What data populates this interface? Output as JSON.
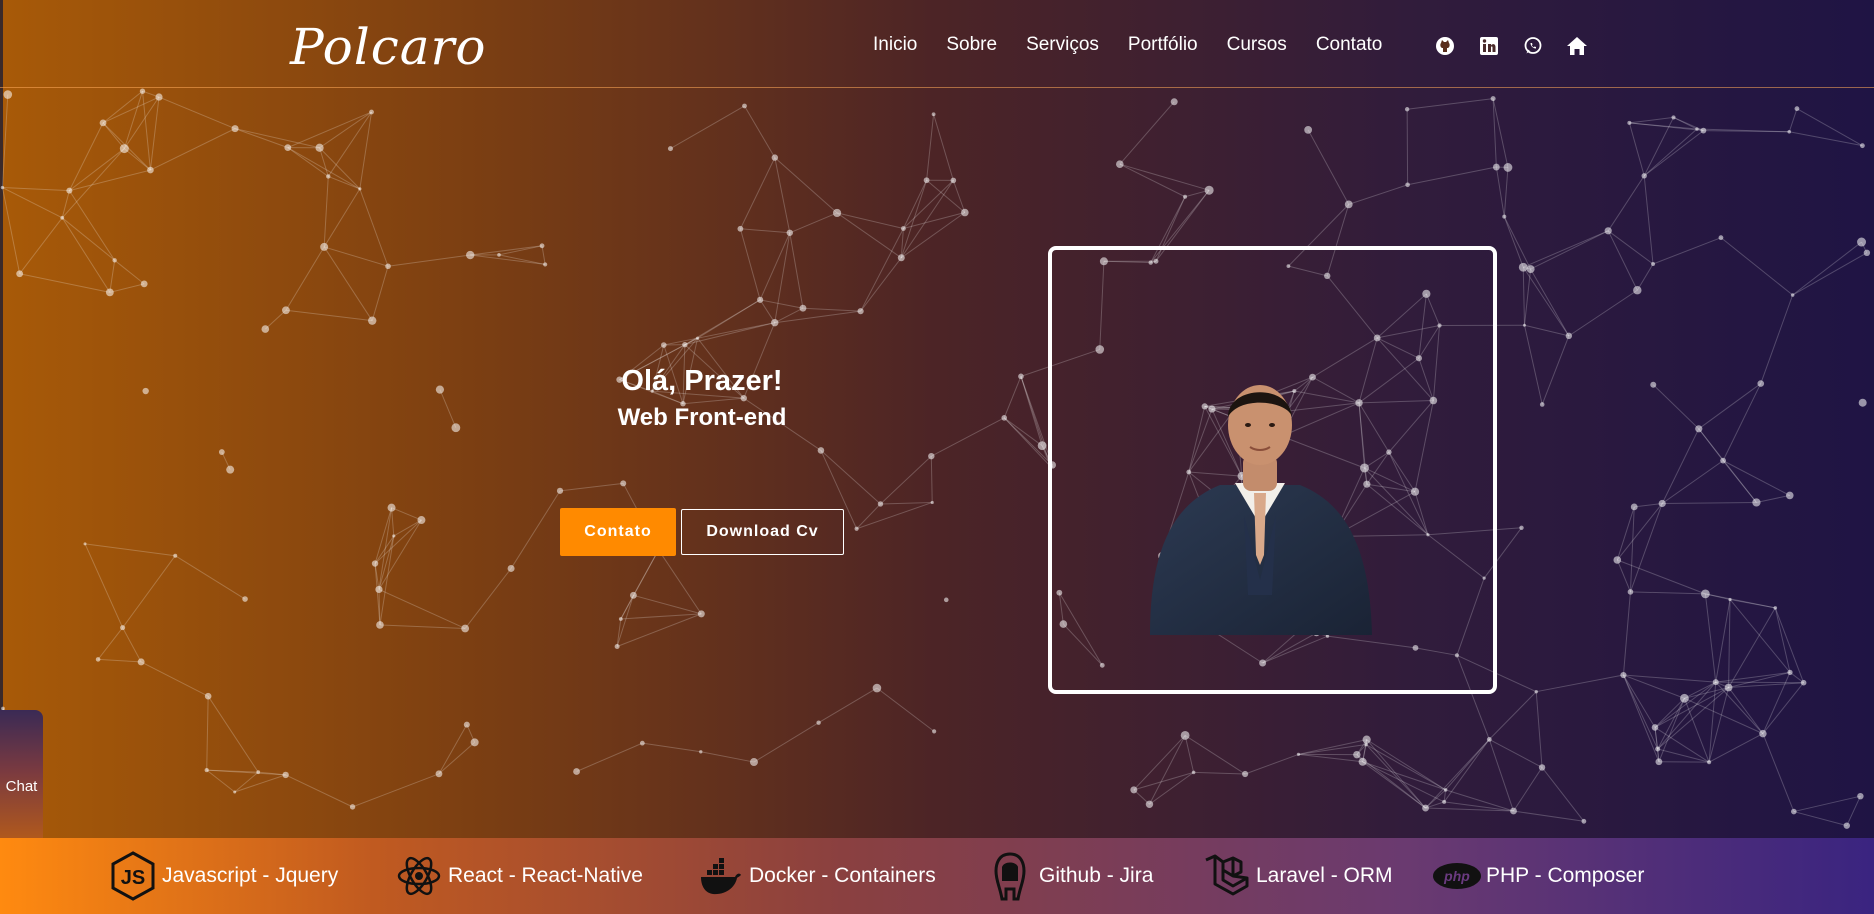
{
  "header": {
    "logo": "Polcaro",
    "nav": [
      "Inicio",
      "Sobre",
      "Serviços",
      "Portfólio",
      "Cursos",
      "Contato"
    ],
    "social_icons": [
      "github-icon",
      "linkedin-icon",
      "whatsapp-icon",
      "home-icon"
    ]
  },
  "hero": {
    "greeting": "Olá, Prazer!",
    "role": "Web Front-end",
    "contact_button": "Contato",
    "download_button": "Download Cv"
  },
  "chat": {
    "label": "Chat"
  },
  "skills": [
    {
      "label": "Javascript - Jquery",
      "icon": "javascript-icon"
    },
    {
      "label": "React - React-Native",
      "icon": "react-icon"
    },
    {
      "label": "Docker - Containers",
      "icon": "docker-icon"
    },
    {
      "label": "Github - Jira",
      "icon": "github-icon"
    },
    {
      "label": "Laravel - ORM",
      "icon": "laravel-icon"
    },
    {
      "label": "PHP - Composer",
      "icon": "php-icon"
    }
  ],
  "colors": {
    "accent": "#ff8a00",
    "gradient_start": "#a85a08",
    "gradient_end": "#1f1444"
  }
}
